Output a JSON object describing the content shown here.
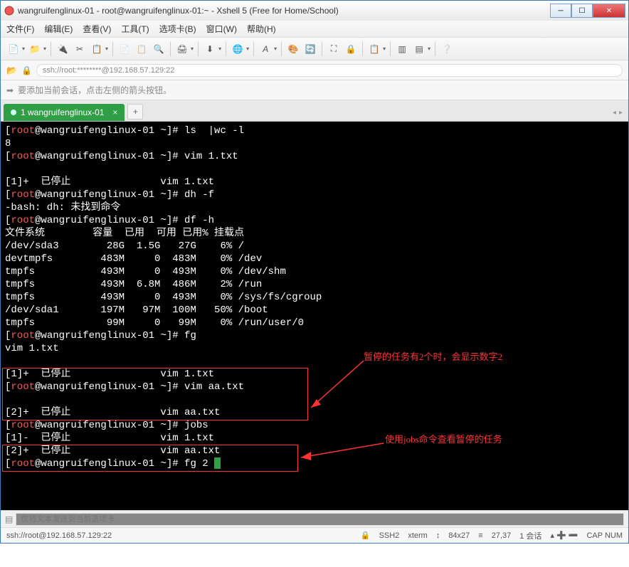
{
  "title": "wangruifenglinux-01 - root@wangruifenglinux-01:~ - Xshell 5 (Free for Home/School)",
  "menu": [
    "文件(F)",
    "编辑(E)",
    "查看(V)",
    "工具(T)",
    "选项卡(B)",
    "窗口(W)",
    "帮助(H)"
  ],
  "address": "ssh://root:********@192.168.57.129:22",
  "hint": "要添加当前会话，点击左侧的箭头按钮。",
  "tab": {
    "label": "1 wangruifenglinux-01"
  },
  "terminal_lines": [
    "[root@wangruifenglinux-01 ~]# ls  |wc -l",
    "8",
    "[root@wangruifenglinux-01 ~]# vim 1.txt",
    "",
    "[1]+  已停止               vim 1.txt",
    "[root@wangruifenglinux-01 ~]# dh -f",
    "-bash: dh: 未找到命令",
    "[root@wangruifenglinux-01 ~]# df -h",
    "文件系统        容量  已用  可用 已用% 挂载点",
    "/dev/sda3        28G  1.5G   27G    6% /",
    "devtmpfs        483M     0  483M    0% /dev",
    "tmpfs           493M     0  493M    0% /dev/shm",
    "tmpfs           493M  6.8M  486M    2% /run",
    "tmpfs           493M     0  493M    0% /sys/fs/cgroup",
    "/dev/sda1       197M   97M  100M   50% /boot",
    "tmpfs            99M     0   99M    0% /run/user/0",
    "[root@wangruifenglinux-01 ~]# fg",
    "vim 1.txt",
    "",
    "[1]+  已停止               vim 1.txt",
    "[root@wangruifenglinux-01 ~]# vim aa.txt",
    "",
    "[2]+  已停止               vim aa.txt",
    "[root@wangruifenglinux-01 ~]# jobs",
    "[1]-  已停止               vim 1.txt",
    "[2]+  已停止               vim aa.txt",
    "[root@wangruifenglinux-01 ~]# fg 2 "
  ],
  "prompt_user": "root",
  "prompt_host": "wangruifenglinux-01",
  "prompt_indices": [
    0,
    2,
    5,
    7,
    16,
    20,
    23,
    26
  ],
  "annotations": {
    "text1": "暂停的任务有2个时，会显示数字2",
    "text2": "使用jobs命令查看暂停的任务"
  },
  "footer_placeholder": "仅将文本发送到当前选项卡",
  "status": {
    "left": "ssh://root@192.168.57.129:22",
    "ssh": "SSH2",
    "term": "xterm",
    "size": "84x27",
    "pos": "27,37",
    "sessions": "1 会话",
    "ext": "CAP  NUM"
  }
}
